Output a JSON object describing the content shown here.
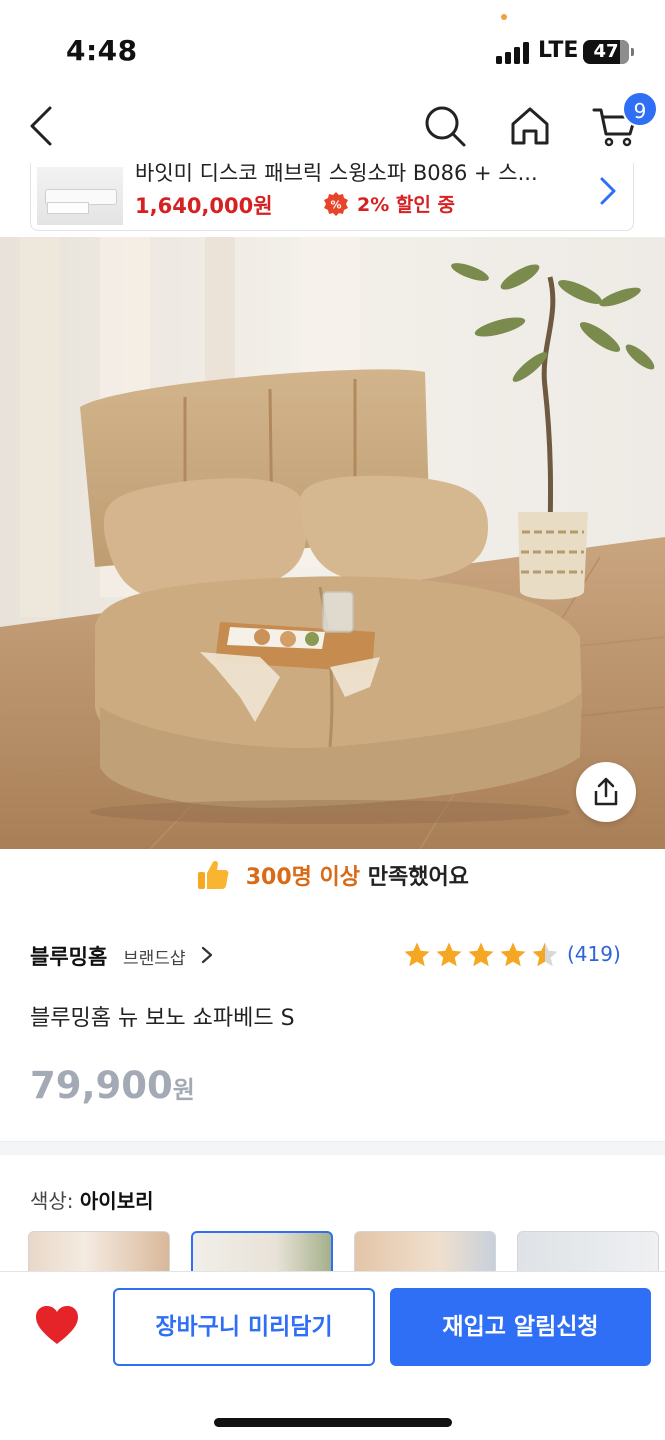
{
  "status_bar": {
    "time": "4:48",
    "network": "LTE",
    "battery": "47"
  },
  "nav": {
    "cart_count": "9",
    "icons": [
      "chevron-left-icon",
      "search-icon",
      "home-icon",
      "cart-icon"
    ]
  },
  "recommendation": {
    "title": "바잇미 디스코 패브릭 스윙소파 B086 + 스...",
    "price": "1,640,000원",
    "discount": "2% 할인 중"
  },
  "satisfaction": {
    "highlight": "300명 이상",
    "rest": "만족했어요"
  },
  "product": {
    "brand": "블루밍홈",
    "brand_shop": "브랜드샵",
    "rating": 4.5,
    "review_count": "(419)",
    "name": "블루밍홈 뉴 보노 쇼파베드 S",
    "price": "79,900",
    "price_unit": "원"
  },
  "options": {
    "color_label": "색상:",
    "color_value": "아이보리",
    "selected_index": 1
  },
  "bottom_bar": {
    "cart_button": "장바구니 미리담기",
    "notify_button": "재입고 알림신청"
  },
  "colors": {
    "accent": "#2f6ff5",
    "price_red": "#d52121",
    "star": "#f5a623",
    "heart": "#e5242a",
    "satisfaction": "#d96a16"
  }
}
